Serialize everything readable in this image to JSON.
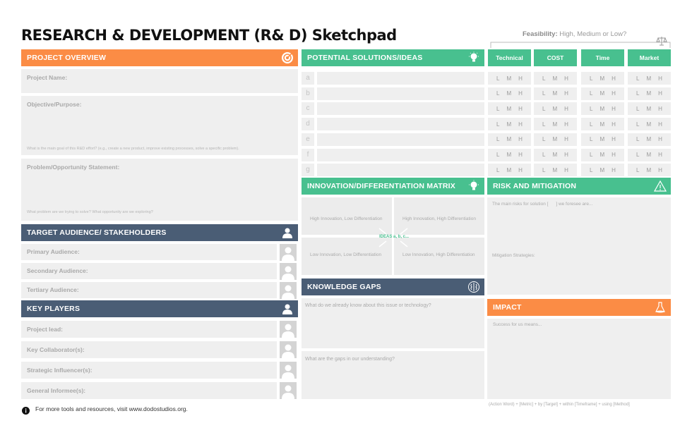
{
  "title": "RESEARCH & DEVELOPMENT (R& D) Sketchpad",
  "feasibility": {
    "label": "Feasibility:",
    "options_text": "High, Medium or Low?"
  },
  "project_overview": {
    "header": "PROJECT OVERVIEW",
    "project_name_label": "Project Name:",
    "objective_label": "Objective/Purpose:",
    "objective_hint": "What is the main goal of this R&D effort? (e.g., create a new product, improve existing processes, solve a specific problem).",
    "problem_label": "Problem/Opportunity Statement:",
    "problem_hint": "What problem are we trying to solve? What opportunity are we exploring?"
  },
  "target_audience": {
    "header": "TARGET AUDIENCE/ STAKEHOLDERS",
    "rows": [
      "Primary Audience:",
      "Secondary Audience:",
      "Tertiary Audience:"
    ]
  },
  "key_players": {
    "header": "KEY PLAYERS",
    "rows": [
      "Project lead:",
      "Key Collaborator(s):",
      "Strategic Influencer(s):",
      "General Informee(s):"
    ]
  },
  "solutions": {
    "header": "POTENTIAL SOLUTIONS/IDEAS",
    "letters": [
      "a",
      "b",
      "c",
      "d",
      "e",
      "f",
      "g"
    ]
  },
  "feasibility_columns": [
    {
      "label": "Technical",
      "levels": [
        "L",
        "M",
        "H"
      ]
    },
    {
      "label": "COST",
      "levels": [
        "L",
        "M",
        "H"
      ]
    },
    {
      "label": "Time",
      "levels": [
        "L",
        "M",
        "H"
      ]
    },
    {
      "label": "Market",
      "levels": [
        "L",
        "M",
        "H"
      ]
    }
  ],
  "matrix": {
    "header": "INNOVATION/DIFFERENTIATION MATRIX",
    "q_top_left": "High Innovation, Low Differentiation",
    "q_top_right": "High Innovation, High Differentiation",
    "q_bottom_left": "Low Innovation, Low Differentiation",
    "q_bottom_right": "Low Innovation, High Differentiation",
    "center_label": "IDEAS a, b, c..."
  },
  "knowledge_gaps": {
    "header": "KNOWLEDGE GAPS",
    "q1": "What do we already know about this issue or technology?",
    "q2": "What are the gaps in our understanding?"
  },
  "risk": {
    "header": "RISK AND MITIGATION",
    "risks_prefix": "The main risks for solution [",
    "risks_suffix": "] we foresee are...",
    "mitigation": "Mitigation Strategies:"
  },
  "impact": {
    "header": "IMPACT",
    "prompt": "Success for us means...",
    "formula": "(Action Word) + [Metric] + by [Target] + within [Timeframe] + using [Method]"
  },
  "footer": {
    "text": "For more tools and resources, visit www.dodostudios.org."
  },
  "colors": {
    "orange": "#fb8c45",
    "green": "#48c08f",
    "navy": "#4a5d75",
    "panel": "#efefef"
  },
  "icons": [
    "target-icon",
    "lightbulb-icon",
    "scale-icon",
    "person-icon",
    "brain-icon",
    "warning-icon",
    "beaker-icon",
    "info-icon"
  ]
}
